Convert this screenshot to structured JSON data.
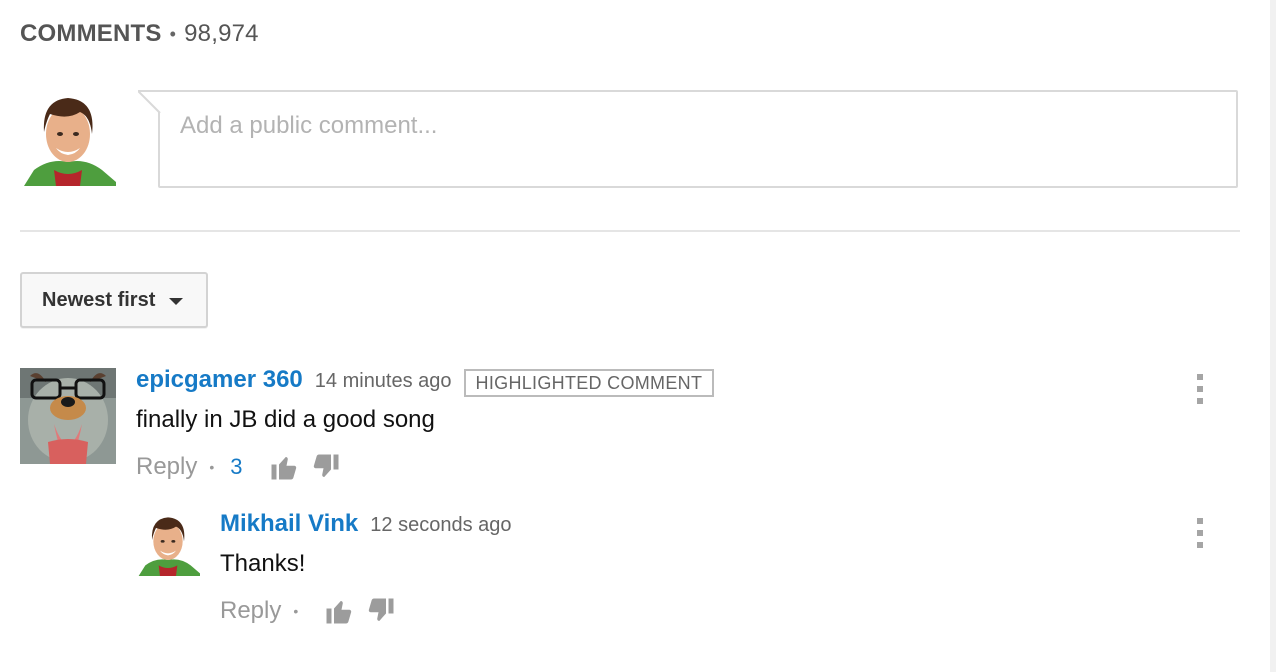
{
  "header": {
    "title": "COMMENTS",
    "separator": "•",
    "count": "98,974"
  },
  "compose": {
    "placeholder": "Add a public comment..."
  },
  "sort": {
    "label": "Newest first"
  },
  "comments": [
    {
      "author": "epicgamer 360",
      "time": "14 minutes ago",
      "badge": "HIGHLIGHTED COMMENT",
      "text": "finally in JB did a good song",
      "reply_label": "Reply",
      "separator": "•",
      "likes": "3"
    }
  ],
  "replies": [
    {
      "author": "Mikhail Vink",
      "time": "12 seconds ago",
      "text": "Thanks!",
      "reply_label": "Reply",
      "separator": "•"
    }
  ],
  "colors": {
    "link": "#167ac6",
    "muted": "#999999",
    "border": "#d9d9d9"
  },
  "icons": {
    "like": "thumb-up-icon",
    "dislike": "thumb-down-icon",
    "menu": "more-vertical-icon",
    "sort": "caret-down-icon"
  }
}
